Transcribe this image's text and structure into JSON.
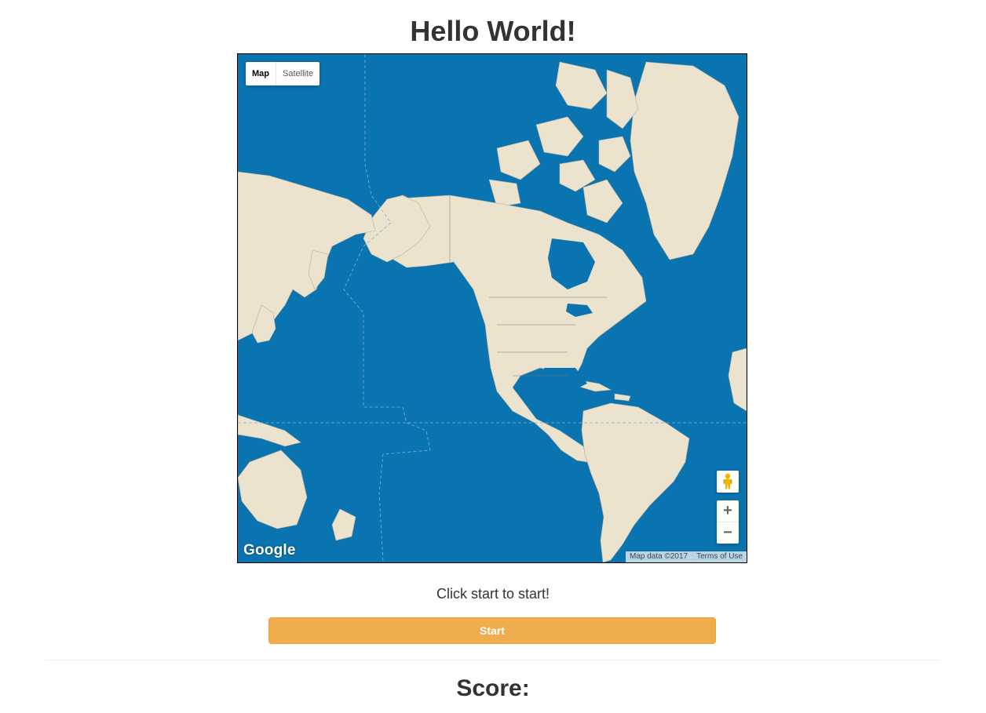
{
  "page": {
    "title": "Hello World!",
    "prompt": "Click start to start!",
    "start_label": "Start",
    "score_label": "Score:"
  },
  "map": {
    "type_controls": {
      "map_label": "Map",
      "satellite_label": "Satellite",
      "selected": "Map"
    },
    "zoom_in_label": "+",
    "zoom_out_label": "−",
    "logo_text": "Google",
    "attribution": "Map data ©2017",
    "terms_label": "Terms of Use",
    "icons": {
      "pegman": "street-view-pegman-icon"
    },
    "colors": {
      "water": "#0a74b0",
      "land": "#ebe3cd",
      "border": "#555555"
    }
  },
  "colors": {
    "start_button": "#f0ad4e",
    "text": "#333333"
  }
}
